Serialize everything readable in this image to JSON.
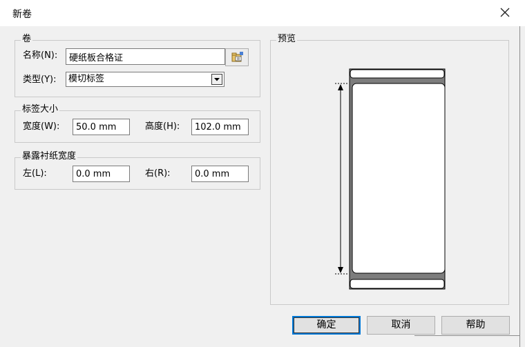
{
  "window": {
    "title": "新卷"
  },
  "roll": {
    "legend": "卷",
    "name_label": "名称(N):",
    "name_value": "硬纸板合格证",
    "type_label": "类型(Y):",
    "type_value": "模切标签"
  },
  "label_size": {
    "legend": "标签大小",
    "width_label": "宽度(W):",
    "width_value": "50.0 mm",
    "height_label": "高度(H):",
    "height_value": "102.0 mm"
  },
  "liner": {
    "legend": "暴露衬纸宽度",
    "left_label": "左(L):",
    "left_value": "0.0 mm",
    "right_label": "右(R):",
    "right_value": "0.0 mm"
  },
  "preview": {
    "legend": "预览"
  },
  "buttons": {
    "ok": "确定",
    "cancel": "取消",
    "help": "帮助"
  },
  "icons": {
    "close": "close-icon",
    "browse": "folder-browse-icon",
    "dropdown": "chevron-down-icon"
  }
}
